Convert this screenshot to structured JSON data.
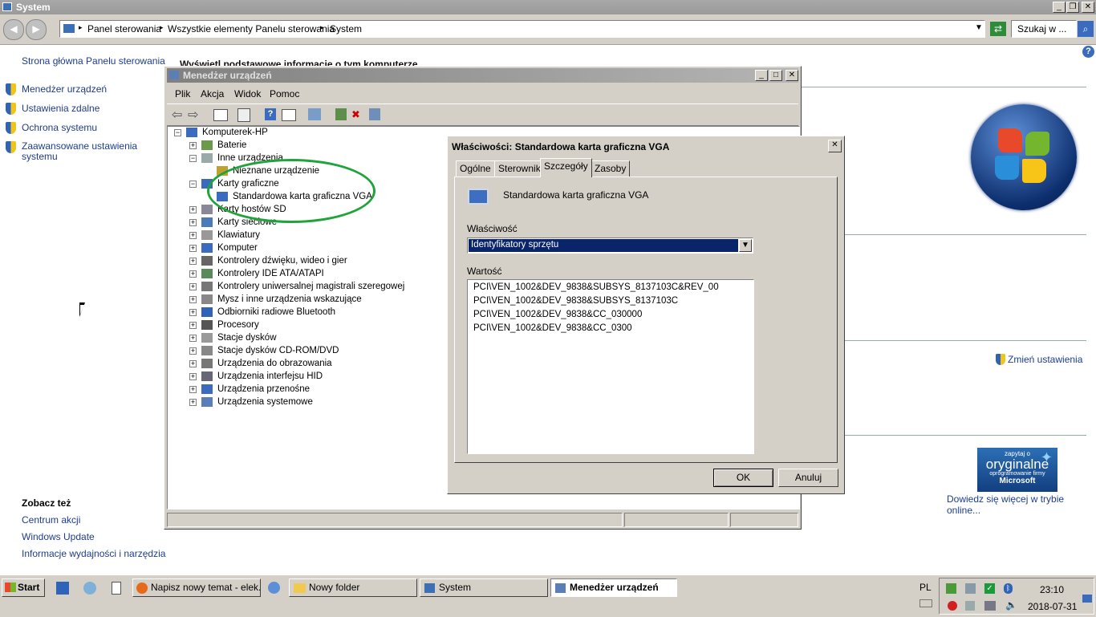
{
  "system_window": {
    "title": "System",
    "breadcrumb": [
      "Panel sterowania",
      "Wszystkie elementy Panelu sterowania",
      "System"
    ],
    "search_placeholder": "Szukaj w ...",
    "heading_partial": "Wyświetl podstawowe informacje o tym komputerze",
    "left_home": "Strona główna Panelu sterowania",
    "left_items": [
      "Menedżer urządzeń",
      "Ustawienia zdalne",
      "Ochrona systemu",
      "Zaawansowane ustawienia systemu"
    ],
    "see_also_title": "Zobacz też",
    "see_also": [
      "Centrum akcji",
      "Windows Update",
      "Informacje wydajności i narzędzia"
    ],
    "change_settings": "Zmień ustawienia",
    "genuine": {
      "line1": "zapytaj o",
      "line2": "oryginalne",
      "line3": "oprogramowanie firmy",
      "line4": "Microsoft"
    },
    "learn_more": "Dowiedz się więcej w trybie online..."
  },
  "device_manager": {
    "title": "Menedżer urządzeń",
    "menu": [
      "Plik",
      "Akcja",
      "Widok",
      "Pomoc"
    ],
    "root": "Komputerek-HP",
    "tree": [
      {
        "label": "Baterie",
        "expanded": false
      },
      {
        "label": "Inne urządzenia",
        "expanded": true
      },
      {
        "label": "Nieznane urządzenie",
        "child": true
      },
      {
        "label": "Karty graficzne",
        "expanded": true
      },
      {
        "label": "Standardowa karta graficzna VGA",
        "child": true
      },
      {
        "label": "Karty hostów SD",
        "expanded": false
      },
      {
        "label": "Karty sieciowe",
        "expanded": false
      },
      {
        "label": "Klawiatury",
        "expanded": false
      },
      {
        "label": "Komputer",
        "expanded": false
      },
      {
        "label": "Kontrolery dźwięku, wideo i gier",
        "expanded": false
      },
      {
        "label": "Kontrolery IDE ATA/ATAPI",
        "expanded": false
      },
      {
        "label": "Kontrolery uniwersalnej magistrali szeregowej",
        "expanded": false
      },
      {
        "label": "Mysz i inne urządzenia wskazujące",
        "expanded": false
      },
      {
        "label": "Odbiorniki radiowe Bluetooth",
        "expanded": false
      },
      {
        "label": "Procesory",
        "expanded": false
      },
      {
        "label": "Stacje dysków",
        "expanded": false
      },
      {
        "label": "Stacje dysków CD-ROM/DVD",
        "expanded": false
      },
      {
        "label": "Urządzenia do obrazowania",
        "expanded": false
      },
      {
        "label": "Urządzenia interfejsu HID",
        "expanded": false
      },
      {
        "label": "Urządzenia przenośne",
        "expanded": false
      },
      {
        "label": "Urządzenia systemowe",
        "expanded": false
      }
    ]
  },
  "properties_dialog": {
    "title": "Właściwości: Standardowa karta graficzna VGA",
    "tabs": [
      "Ogólne",
      "Sterownik",
      "Szczegóły",
      "Zasoby"
    ],
    "active_tab": "Szczegóły",
    "device_name": "Standardowa karta graficzna VGA",
    "property_label": "Właściwość",
    "property_value": "Identyfikatory sprzętu",
    "value_label": "Wartość",
    "values": [
      "PCI\\VEN_1002&DEV_9838&SUBSYS_8137103C&REV_00",
      "PCI\\VEN_1002&DEV_9838&SUBSYS_8137103C",
      "PCI\\VEN_1002&DEV_9838&CC_030000",
      "PCI\\VEN_1002&DEV_9838&CC_0300"
    ],
    "ok": "OK",
    "cancel": "Anuluj"
  },
  "taskbar": {
    "start": "Start",
    "tasks": [
      "Napisz nowy temat - elek...",
      "Nowy folder",
      "System",
      "Menedżer urządzeń"
    ],
    "lang": "PL",
    "time": "23:10",
    "date": "2018-07-31"
  }
}
